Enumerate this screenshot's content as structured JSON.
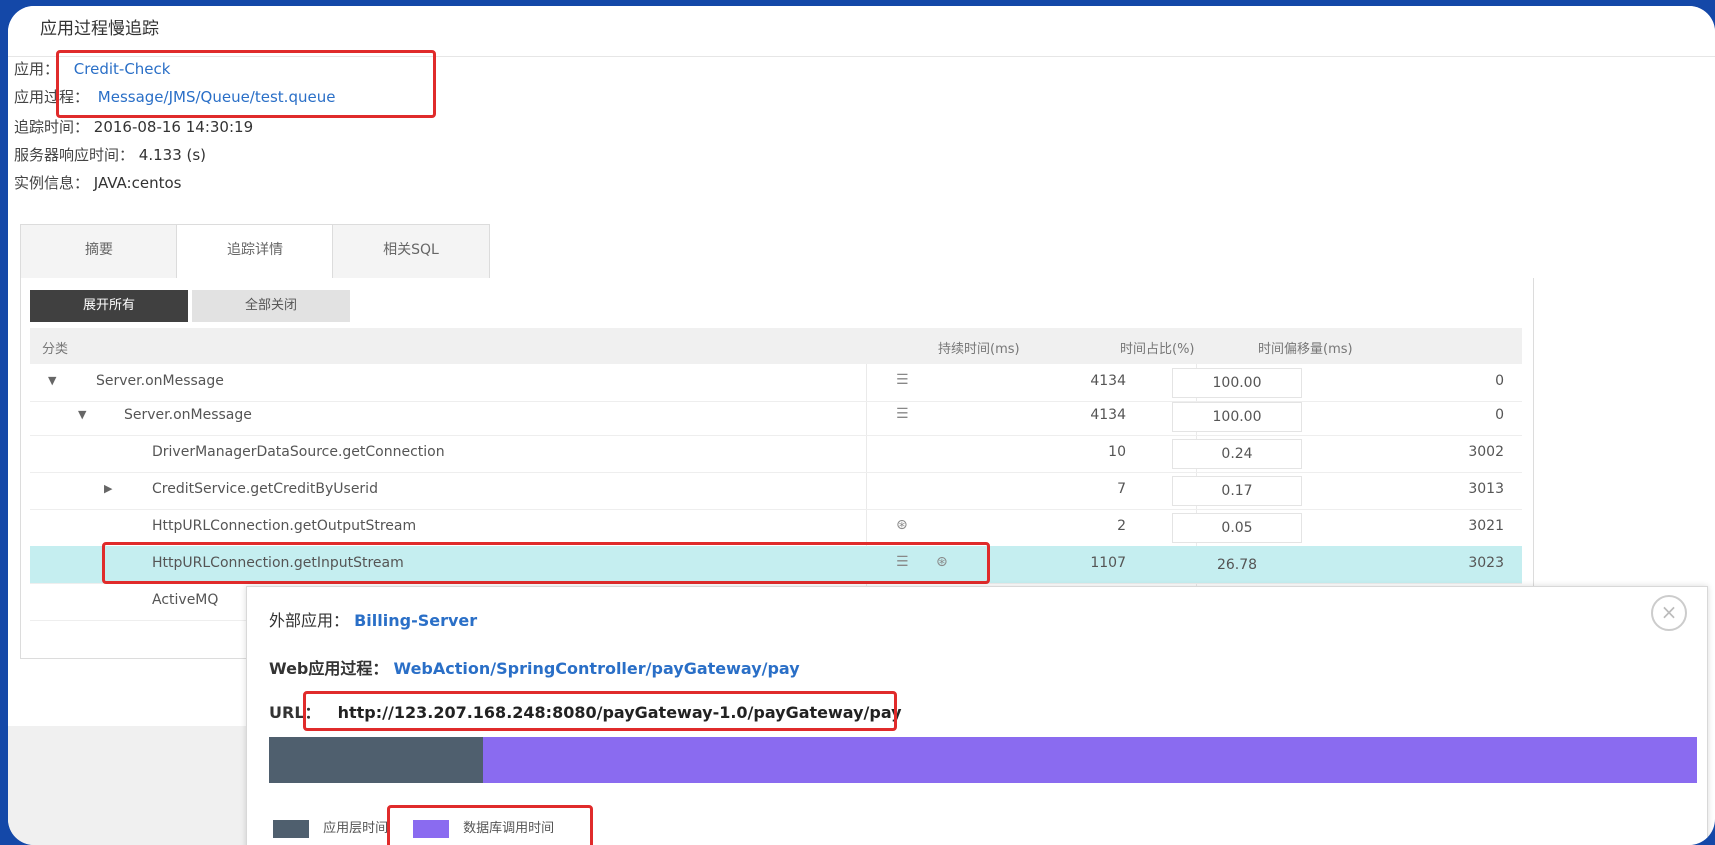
{
  "title": "应用过程慢追踪",
  "info": {
    "app_label": "应用：",
    "app_value": "Credit-Check",
    "process_label": "应用过程：",
    "process_value": "Message/JMS/Queue/test.queue",
    "time_label": "追踪时间：",
    "time_value": "2016-08-16 14:30:19",
    "resp_label": "服务器响应时间：",
    "resp_value": "4.133 (s)",
    "instance_label": "实例信息：",
    "instance_value": "JAVA:centos"
  },
  "tabs": [
    "摘要",
    "追踪详情",
    "相关SQL"
  ],
  "buttons": {
    "expand": "展开所有",
    "collapse": "全部关闭"
  },
  "table": {
    "headers": [
      "分类",
      "持续时间(ms)",
      "时间占比(%)",
      "时间偏移量(ms)"
    ],
    "rows": [
      {
        "name": "Server.onMessage",
        "duration": "4134",
        "percent": "100.00",
        "offset": "0"
      },
      {
        "name": "Server.onMessage",
        "duration": "4134",
        "percent": "100.00",
        "offset": "0"
      },
      {
        "name": "DriverManagerDataSource.getConnection",
        "duration": "10",
        "percent": "0.24",
        "offset": "3002"
      },
      {
        "name": "CreditService.getCreditByUserid",
        "duration": "7",
        "percent": "0.17",
        "offset": "3013"
      },
      {
        "name": "HttpURLConnection.getOutputStream",
        "duration": "2",
        "percent": "0.05",
        "offset": "3021"
      },
      {
        "name": "HttpURLConnection.getInputStream",
        "duration": "1107",
        "percent": "26.78",
        "offset": "3023"
      },
      {
        "name": "ActiveMQ",
        "duration": "",
        "percent": "",
        "offset": ""
      }
    ]
  },
  "popup": {
    "ext_app_label": "外部应用：",
    "ext_app_value": "Billing-Server",
    "web_label": "Web应用过程：",
    "web_value": "WebAction/SpringController/payGateway/pay",
    "url_label": "URL：",
    "url_value": "http://123.207.168.248:8080/payGateway-1.0/payGateway/pay",
    "close_icon": "close-icon",
    "bar_fraction_app": 0.15,
    "legend_app": "应用层时间",
    "legend_db": "数据库调用时间",
    "colors": {
      "app": "#4f5f6e",
      "db": "#8a6bf0"
    }
  }
}
